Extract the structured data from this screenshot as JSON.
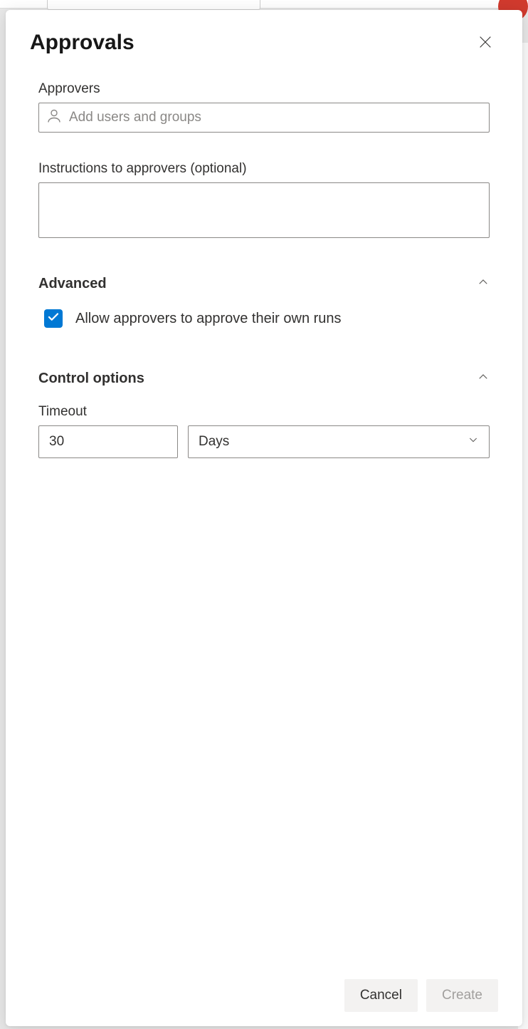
{
  "header": {
    "title": "Approvals"
  },
  "approvers": {
    "label": "Approvers",
    "placeholder": "Add users and groups"
  },
  "instructions": {
    "label": "Instructions to approvers (optional)",
    "value": ""
  },
  "advanced": {
    "title": "Advanced",
    "allow_own_runs": {
      "checked": true,
      "label": "Allow approvers to approve their own runs"
    }
  },
  "control_options": {
    "title": "Control options",
    "timeout": {
      "label": "Timeout",
      "value": "30",
      "unit": "Days"
    }
  },
  "footer": {
    "cancel": "Cancel",
    "create": "Create"
  }
}
